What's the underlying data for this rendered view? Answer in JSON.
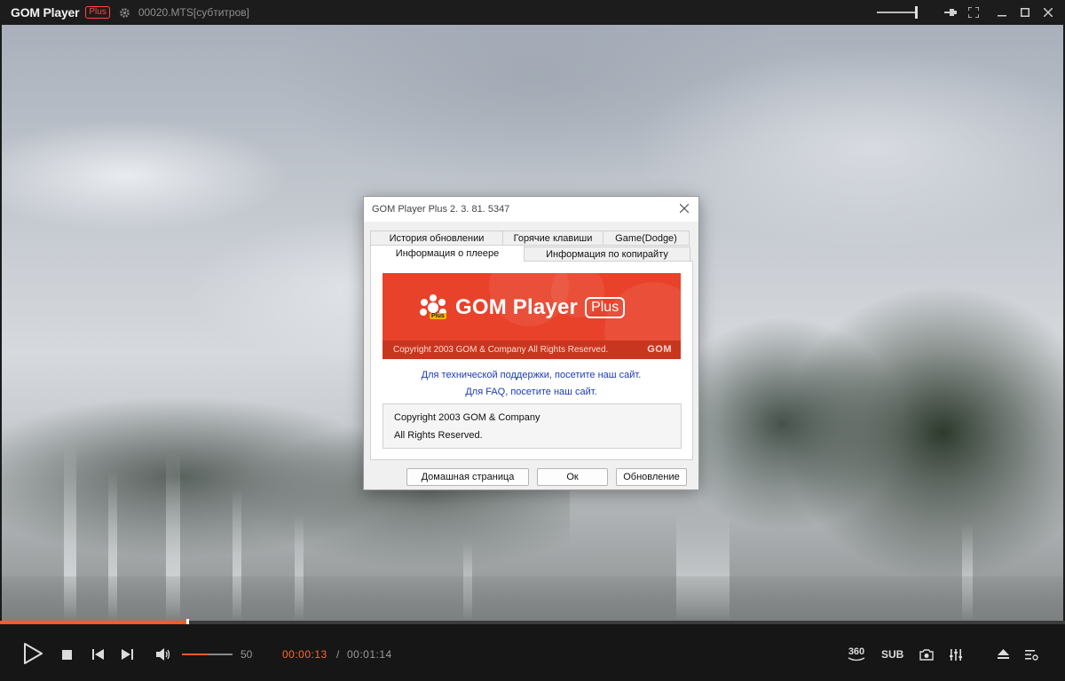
{
  "titlebar": {
    "app_name": "GOM Player",
    "plus_badge": "Plus",
    "file_title": "00020.MTS[субтитров]"
  },
  "dialog": {
    "title": "GOM Player Plus 2. 3. 81. 5347",
    "tabs_top": [
      "История обновлении",
      "Горячие клавиши",
      "Game(Dodge)"
    ],
    "tabs_bottom": [
      "Информация о плеере",
      "Информация по копирайту"
    ],
    "active_tab": "Информация о плеере",
    "banner": {
      "brand": "GOM Player",
      "plus": "Plus",
      "logo_badge": "Plus",
      "copyright": "Copyright 2003 GOM & Company All Rights Reserved.",
      "corner_logo": "GOM"
    },
    "support_link": "Для технической поддержки, посетите наш сайт.",
    "faq_link": "Для FAQ, посетите наш сайт.",
    "info_line1": "Copyright 2003 GOM & Company",
    "info_line2": "All Rights Reserved.",
    "buttons": {
      "home": "Домашная страница",
      "ok": "Ок",
      "update": "Обновление"
    }
  },
  "playback": {
    "progress": 0.176,
    "volume_value": "50",
    "volume_fraction": 0.5,
    "current_time": "00:00:13",
    "separator": "/",
    "total_time": "00:01:14",
    "btn_360": "360",
    "btn_sub": "SUB"
  },
  "colors": {
    "accent": "#ff5a28",
    "banner_red": "#e8422a",
    "link_blue": "#1a3cb5"
  }
}
